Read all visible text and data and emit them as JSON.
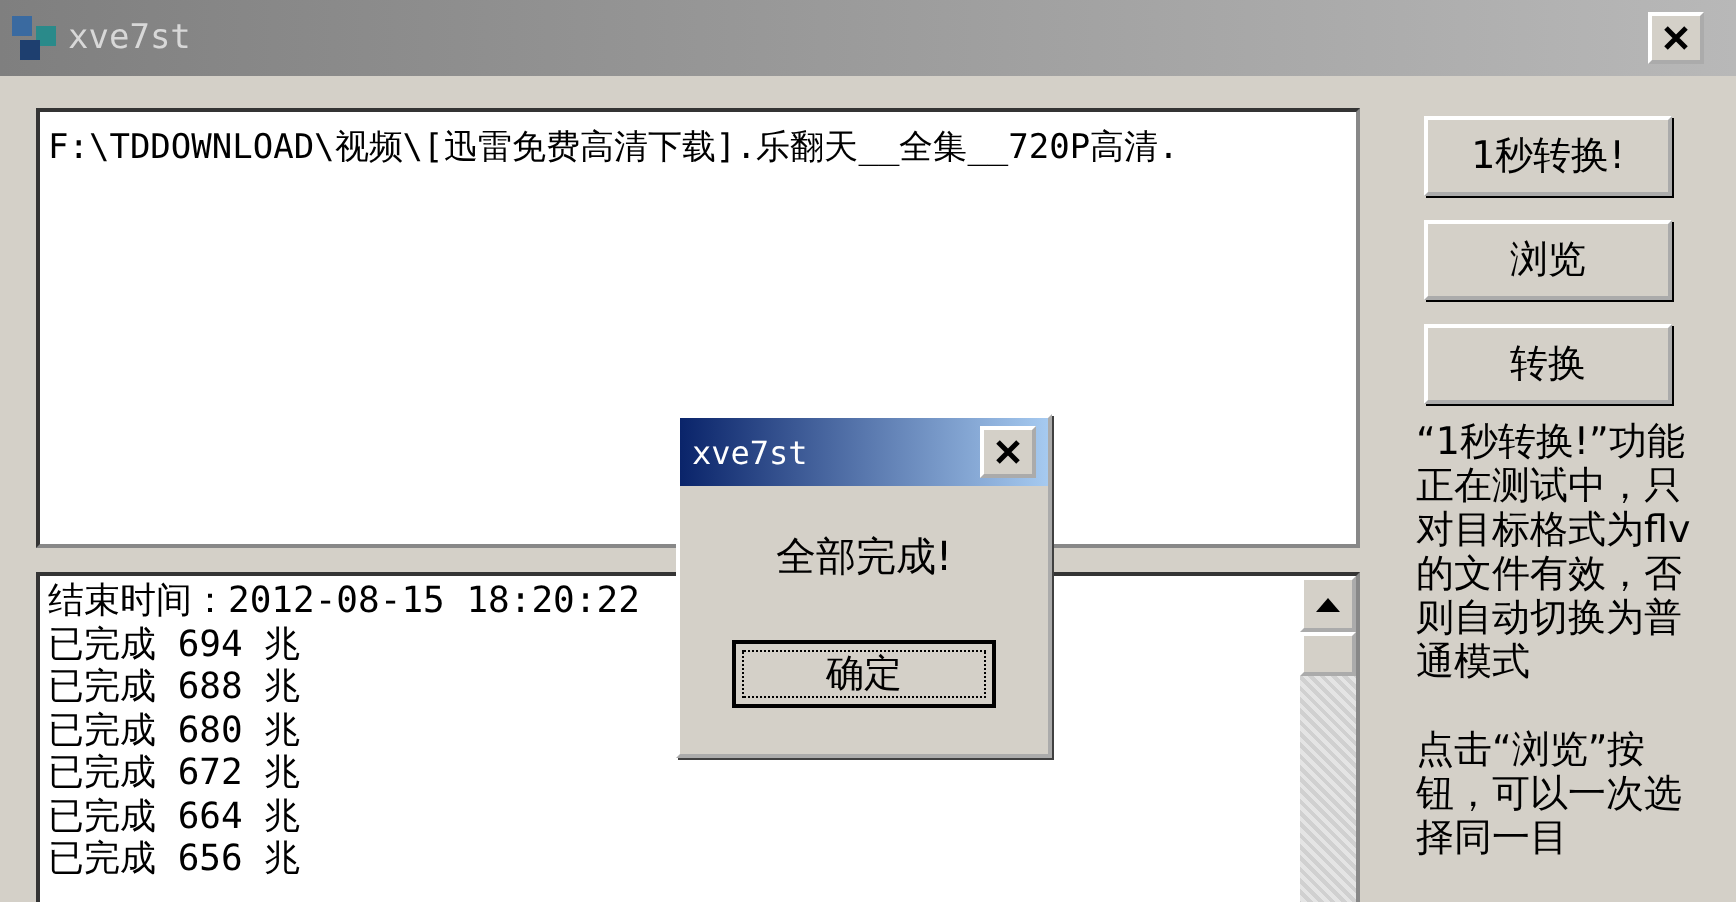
{
  "window": {
    "title": "xve7st"
  },
  "path_field": {
    "value": "F:\\TDDOWNLOAD\\视频\\[迅雷免费高清下载].乐翻天__全集__720P高清."
  },
  "buttons": [
    "1秒转换!",
    "浏览",
    "转换"
  ],
  "info_text": [
    "“1秒转换!”功能正在测试中，只对目标格式为flv的文件有效，否则自动切换为普通模式",
    "点击“浏览”按钮，可以一次选择同一目"
  ],
  "log": {
    "lines": [
      "结束时间：2012-08-15 18:20:22",
      "已完成 694 兆",
      "已完成 688 兆",
      "已完成 680 兆",
      "已完成 672 兆",
      "已完成 664 兆",
      "已完成 656 兆"
    ]
  },
  "dialog": {
    "title": "xve7st",
    "message": "全部完成!",
    "button": "确定"
  }
}
